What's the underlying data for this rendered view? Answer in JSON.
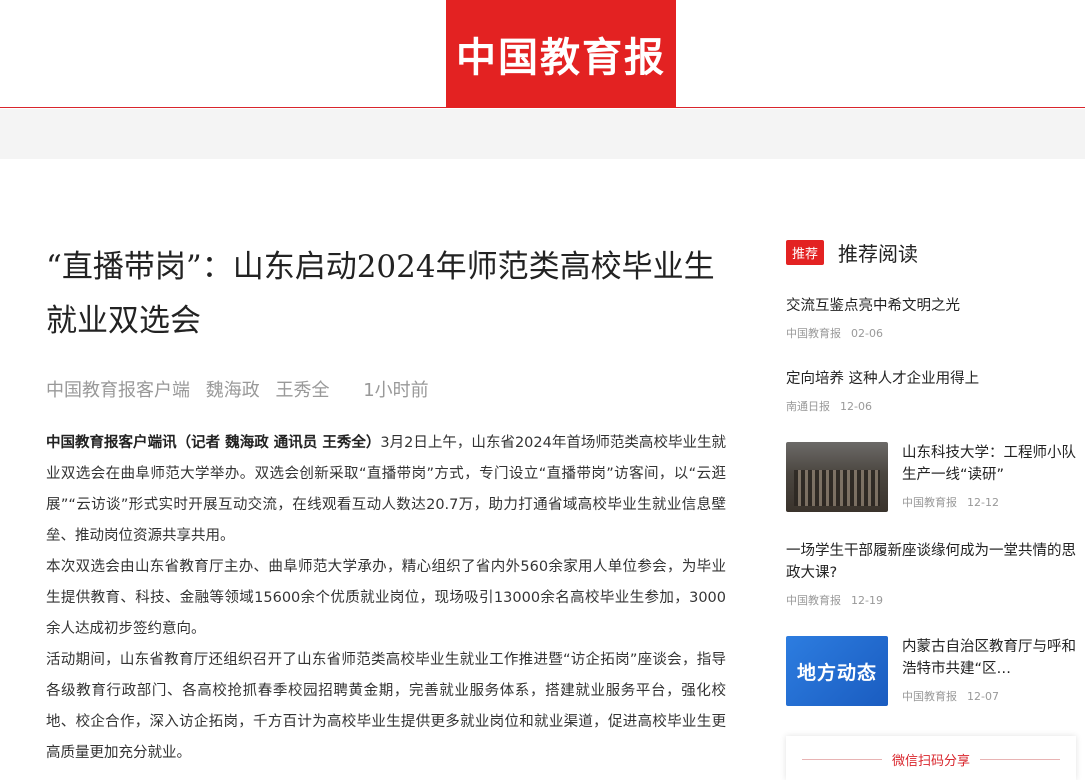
{
  "header": {
    "logo_text": "中国教育报",
    "brand_color": "#e32222"
  },
  "article": {
    "title": "“直播带岗”：山东启动2024年师范类高校毕业生就业双选会",
    "source": "中国教育报客户端",
    "authors": [
      "魏海政",
      "王秀全"
    ],
    "time": "1小时前",
    "lead_bold": "中国教育报客户端讯（记者 魏海政 通讯员 王秀全）",
    "paragraphs": [
      "3月2日上午，山东省2024年首场师范类高校毕业生就业双选会在曲阜师范大学举办。双选会创新采取“直播带岗”方式，专门设立“直播带岗”访客间，以“云逛展”“云访谈”形式实时开展互动交流，在线观看互动人数达20.7万，助力打通省域高校毕业生就业信息壁垒、推动岗位资源共享共用。",
      "本次双选会由山东省教育厅主办、曲阜师范大学承办，精心组织了省内外560余家用人单位参会，为毕业生提供教育、科技、金融等领域15600余个优质就业岗位，现场吸引13000余名高校毕业生参加，3000余人达成初步签约意向。",
      "活动期间，山东省教育厅还组织召开了山东省师范类高校毕业生就业工作推进暨“访企拓岗”座谈会，指导各级教育行政部门、各高校抢抓春季校园招聘黄金期，完善就业服务体系，搭建就业服务平台，强化校地、校企合作，深入访企拓岗，千方百计为高校毕业生提供更多就业岗位和就业渠道，促进高校毕业生更高质量更加充分就业。"
    ]
  },
  "sidebar": {
    "badge": "推荐",
    "heading": "推荐阅读",
    "items": [
      {
        "title": "交流互鉴点亮中希文明之光",
        "source": "中国教育报",
        "date": "02-06"
      },
      {
        "title": "定向培养 这种人才企业用得上",
        "source": "南通日报",
        "date": "12-06"
      },
      {
        "title": "山东科技大学：工程师小队生产一线“读研”",
        "source": "中国教育报",
        "date": "12-12",
        "thumb": "classroom-photo"
      },
      {
        "title": "一场学生干部履新座谈缘何成为一堂共情的思政大课?",
        "source": "中国教育报",
        "date": "12-19"
      },
      {
        "title": "内蒙古自治区教育厅与呼和浩特市共建“区…",
        "source": "中国教育报",
        "date": "12-07",
        "thumb_text": "地方动态"
      }
    ],
    "share_label": "微信扫码分享"
  }
}
